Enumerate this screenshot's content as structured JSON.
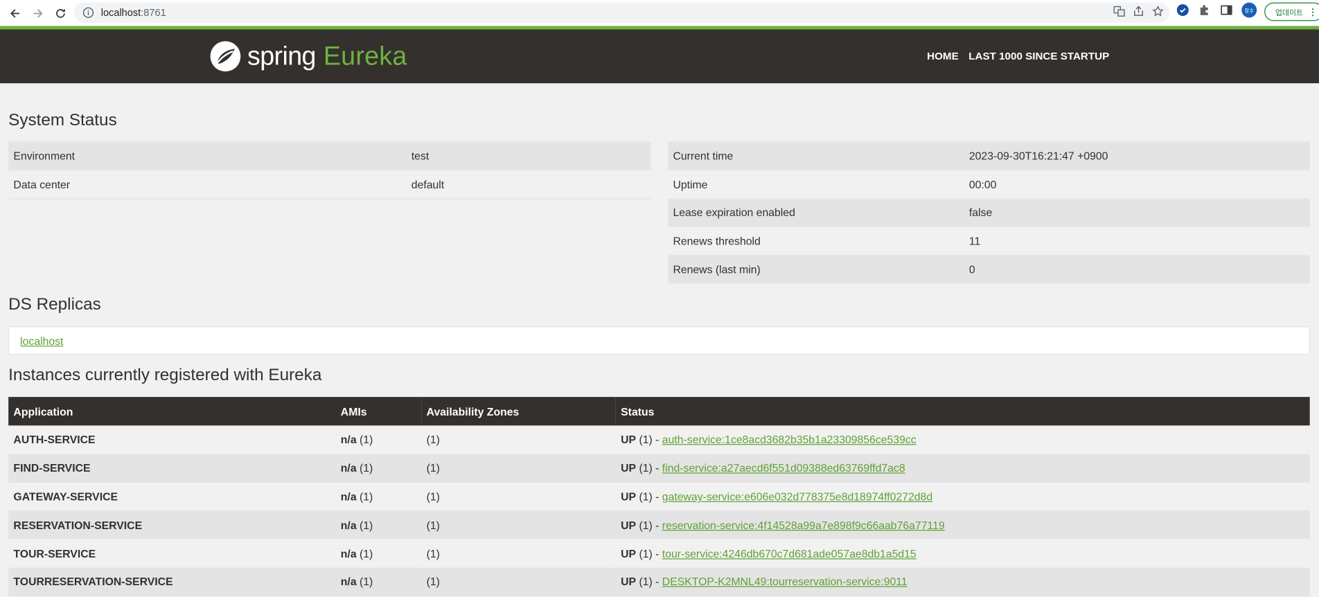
{
  "browser": {
    "url_host": "localhost",
    "url_port": ":8761",
    "avatar_text": "창수",
    "update_label": "업데이트"
  },
  "navbar": {
    "brand_spring": "spring",
    "brand_eureka": "Eureka",
    "links": [
      "HOME",
      "LAST 1000 SINCE STARTUP"
    ]
  },
  "system_status": {
    "title": "System Status",
    "left": [
      {
        "label": "Environment",
        "value": "test"
      },
      {
        "label": "Data center",
        "value": "default"
      }
    ],
    "right": [
      {
        "label": "Current time",
        "value": "2023-09-30T16:21:47 +0900"
      },
      {
        "label": "Uptime",
        "value": "00:00"
      },
      {
        "label": "Lease expiration enabled",
        "value": "false"
      },
      {
        "label": "Renews threshold",
        "value": "11"
      },
      {
        "label": "Renews (last min)",
        "value": "0"
      }
    ]
  },
  "ds_replicas": {
    "title": "DS Replicas",
    "link": "localhost"
  },
  "instances": {
    "title": "Instances currently registered with Eureka",
    "headers": [
      "Application",
      "AMIs",
      "Availability Zones",
      "Status"
    ],
    "rows": [
      {
        "app": "AUTH-SERVICE",
        "ami": "n/a",
        "ami_count": " (1)",
        "zones": "(1)",
        "status": "UP",
        "status_count": " (1) - ",
        "link": "auth-service:1ce8acd3682b35b1a23309856ce539cc"
      },
      {
        "app": "FIND-SERVICE",
        "ami": "n/a",
        "ami_count": " (1)",
        "zones": "(1)",
        "status": "UP",
        "status_count": " (1) - ",
        "link": "find-service:a27aecd6f551d09388ed63769ffd7ac8"
      },
      {
        "app": "GATEWAY-SERVICE",
        "ami": "n/a",
        "ami_count": " (1)",
        "zones": "(1)",
        "status": "UP",
        "status_count": " (1) - ",
        "link": "gateway-service:e606e032d778375e8d18974ff0272d8d"
      },
      {
        "app": "RESERVATION-SERVICE",
        "ami": "n/a",
        "ami_count": " (1)",
        "zones": "(1)",
        "status": "UP",
        "status_count": " (1) - ",
        "link": "reservation-service:4f14528a99a7e898f9c66aab76a77119"
      },
      {
        "app": "TOUR-SERVICE",
        "ami": "n/a",
        "ami_count": " (1)",
        "zones": "(1)",
        "status": "UP",
        "status_count": " (1) - ",
        "link": "tour-service:4246db670c7d681ade057ae8db1a5d15"
      },
      {
        "app": "TOURRESERVATION-SERVICE",
        "ami": "n/a",
        "ami_count": " (1)",
        "zones": "(1)",
        "status": "UP",
        "status_count": " (1) - ",
        "link": "DESKTOP-K2MNL49:tourreservation-service:9011"
      }
    ]
  },
  "colors": {
    "brand_green": "#6db33f",
    "navbar_bg": "#34302d",
    "link_green": "#5fa134"
  }
}
